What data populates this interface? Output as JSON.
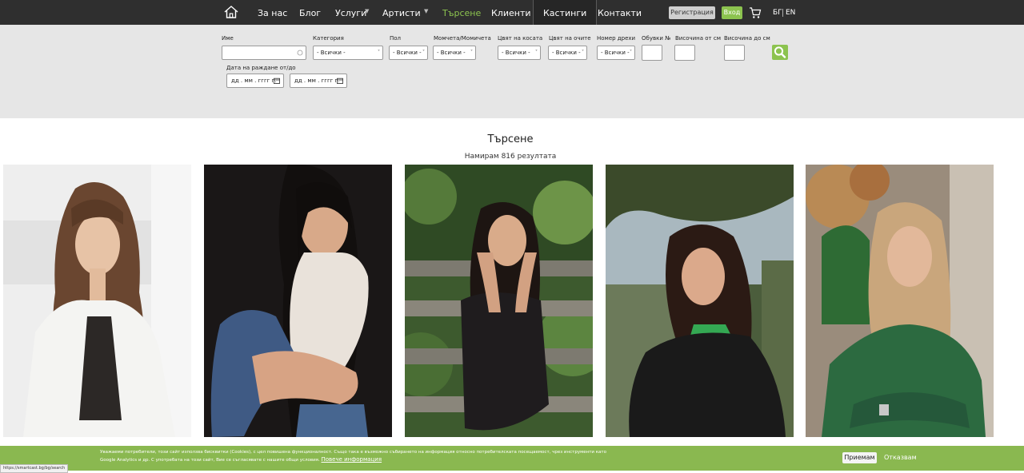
{
  "nav": {
    "items": [
      "За нас",
      "Блог",
      "Услуги",
      "Артисти",
      "Търсене",
      "Клиенти",
      "Кастинги",
      "Контакти"
    ],
    "register": "Регистрация",
    "login": "Вход",
    "lang_bg": "БГ",
    "lang_en": "EN",
    "accent_color": "#8cc34f"
  },
  "filters": {
    "name_label": "Име",
    "category_label": "Категория",
    "category_value": "- Всички -",
    "gender_label": "Пол",
    "gender_value": "- Всички -",
    "kids_label": "Момчета/Момичета",
    "kids_value": "- Всички -",
    "hair_label": "Цвят на косата",
    "hair_value": "- Всички -",
    "eyes_label": "Цвят на очите",
    "eyes_value": "- Всички -",
    "clothes_label": "Номер дрехи",
    "clothes_value": "- Всички -",
    "shoes_label": "Обувки №",
    "height_from_label": "Височина от см",
    "height_to_label": "Височина до см",
    "dob_label": "Дата на раждане от/до",
    "date_placeholder": "дд . мм . гггг  г."
  },
  "results": {
    "title": "Търсене",
    "count_text": "Намирам 816 резултата"
  },
  "cookie": {
    "text": "Уважаеми потребители, този сайт използва бисквитки (Cookies), с цел повишена функционалност. Също така е възможно събирането на информация относно потребителската посещаемост, чрез инструменти като Google Analytics и др. С употребата на този сайт, Вие се съгласявате с нашите общи условия.",
    "more_link": "Повече информация",
    "accept": "Приемам",
    "decline": "Отказвам"
  },
  "status_url": "https://smartcast.bg/bg/search"
}
